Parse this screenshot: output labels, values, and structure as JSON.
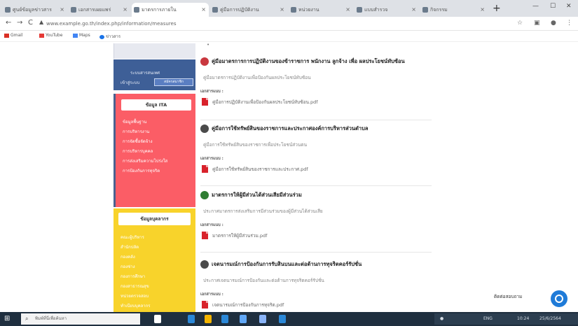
{
  "browser": {
    "tabs": [
      {
        "label": "ศูนย์ข้อมูลข่าวสาร"
      },
      {
        "label": "เอกสารเผยแพร่"
      },
      {
        "label": "มาตรการภายใน"
      },
      {
        "label": "คู่มือการปฏิบัติงาน"
      },
      {
        "label": "หน่วยงาน"
      },
      {
        "label": "แบบสำรวจ"
      },
      {
        "label": "กิจกรรม"
      }
    ],
    "url": "www.example.go.th/index.php/information/measures",
    "bookmarks": [
      "Gmail",
      "YouTube",
      "Maps",
      "ข่าวสาร"
    ],
    "bookmark_colors": [
      "#d93025",
      "#e53935",
      "#4285f4",
      "#1a73e8"
    ]
  },
  "sidebar": {
    "blue_box": {
      "line1": "ระบบสารสนเทศ",
      "line2": "เข้าสู่ระบบ",
      "button": "สมัครสมาชิก"
    },
    "red_box": {
      "heading": "ข้อมูล ITA",
      "links": [
        "ข้อมูลพื้นฐาน",
        "การบริหารงาน",
        "การจัดซื้อจัดจ้าง",
        "การบริหารบุคคล",
        "การส่งเสริมความโปร่งใส",
        "การป้องกันการทุจริต"
      ]
    },
    "yellow_box": {
      "heading": "ข้อมูลบุคลากร",
      "links": [
        "คณะผู้บริหาร",
        "สำนักปลัด",
        "กองคลัง",
        "กองช่าง",
        "กองการศึกษา",
        "กองสาธารณสุข",
        "หน่วยตรวจสอบ",
        "ทำเนียบบุคลากร"
      ]
    }
  },
  "main": {
    "small_glyph": "•",
    "attachment_label": "เอกสารแนบ :",
    "sections": [
      {
        "title": "คู่มือมาตรการการปฏิบัติงานของข้าราชการ พนักงาน ลูกจ้าง เพื่อ ผลประโยชน์ทับซ้อน",
        "desc": "คู่มือมาตรการปฏิบัติงานเพื่อป้องกันผลประโยชน์ทับซ้อน",
        "attachment": "คู่มือการปฏิบัติงานเพื่อป้องกันผลประโยชน์ทับซ้อน.pdf",
        "icon_color": "#c9383f"
      },
      {
        "title": "คู่มือการใช้ทรัพย์สินของราชการและประกาศองค์การบริหารส่วนตำบล",
        "desc": "คู่มือการใช้ทรัพย์สินของราชการเพื่อประโยชน์ส่วนตน",
        "attachment": "คู่มือการใช้ทรัพย์สินของราชการและประกาศ.pdf",
        "icon_color": "#4a4a4a"
      },
      {
        "title": "มาตรการให้ผู้มีส่วนได้ส่วนเสียมีส่วนร่วม",
        "desc": "ประกาศมาตรการส่งเสริมการมีส่วนร่วมของผู้มีส่วนได้ส่วนเสีย",
        "attachment": "มาตรการให้ผู้มีส่วนร่วม.pdf",
        "icon_color": "#2f7d32"
      },
      {
        "title": "เจตนารมณ์การป้องกันการรับสินบนและต่อต้านการทุจริตคอร์รัปชั่น",
        "desc": "ประกาศเจตนารมณ์การป้องกันและต่อต้านการทุจริตคอร์รัปชั่น",
        "attachment": "เจตนารมณ์การป้องกันการทุจริต.pdf",
        "icon_color": "#4a4a4a"
      }
    ]
  },
  "chat": {
    "label": "ติดต่อสอบถาม"
  },
  "taskbar": {
    "search_placeholder": "พิมพ์ที่นี่เพื่อค้นหา",
    "apps": [
      "#ffffff",
      "#2b88d8",
      "#f3b400",
      "#2b88d8",
      "#61a8f7",
      "#8ab4f8",
      "#2b88d8"
    ],
    "tray": [
      "ENG",
      "10:24",
      "25/6/2564"
    ]
  },
  "colors": {
    "blue_box": "#3e5f97",
    "red_box": "#fb5d66",
    "yellow_box": "#f8d32b",
    "chat": "#1f7bd8",
    "taskbar": "#1f2f3f"
  }
}
